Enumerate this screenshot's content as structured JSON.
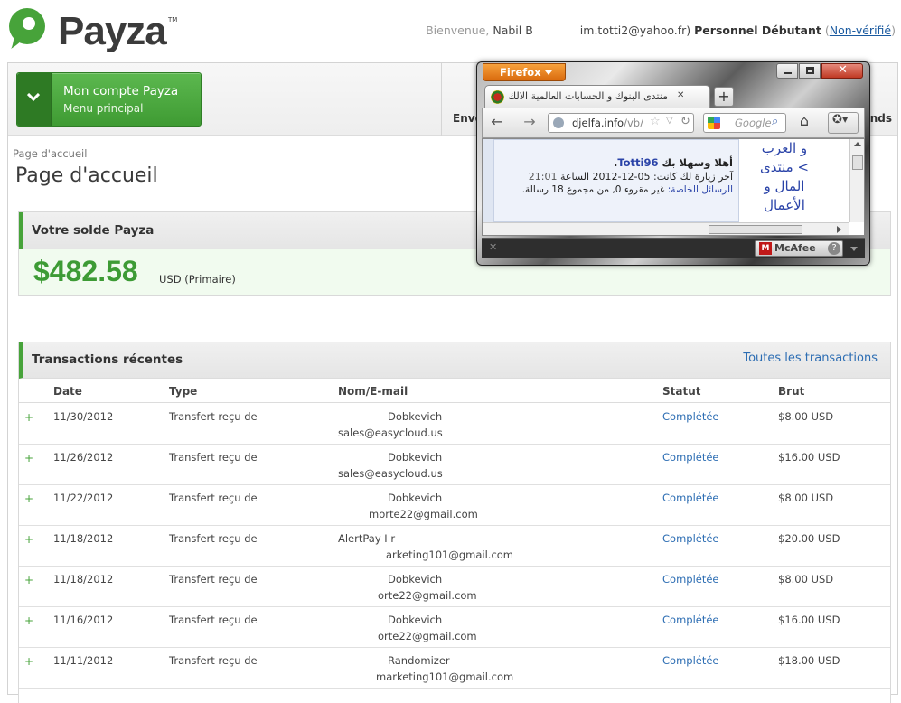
{
  "brand": {
    "name": "Payza",
    "tm": "TM",
    "colors": {
      "green": "#47a33a",
      "dark_text": "#3b3b3b",
      "link": "#2c6db3"
    }
  },
  "userbar": {
    "welcome": "Bienvenue,",
    "name": "Nabil B",
    "email_fragment": "im.totti2@yahoo.fr)",
    "level": "Personnel Débutant",
    "open_paren": "(",
    "verify_link": "Non-vérifié",
    "close_paren": ")"
  },
  "nav": {
    "account_button": {
      "line1": "Mon compte Payza",
      "line2": "Menu principal"
    },
    "envoyer": "Envoy",
    "funds": "nds"
  },
  "breadcrumb": "Page d'accueil",
  "page_title": "Page d'accueil",
  "balance": {
    "header": "Votre solde Payza",
    "amount": "$482.58",
    "currency": "USD (Primaire)"
  },
  "transactions": {
    "header": "Transactions récentes",
    "all_link": "Toutes les transactions",
    "columns": [
      "Date",
      "Type",
      "Nom/E-mail",
      "Statut",
      "Brut"
    ],
    "rows": [
      {
        "sign": "+",
        "date": "11/30/2012",
        "type": "Transfert reçu de",
        "name": "Dobkevich",
        "email": "sales@easycloud.us",
        "status": "Complétée",
        "amount": "$8.00 USD"
      },
      {
        "sign": "+",
        "date": "11/26/2012",
        "type": "Transfert reçu de",
        "name": "Dobkevich",
        "email": "sales@easycloud.us",
        "status": "Complétée",
        "amount": "$16.00 USD"
      },
      {
        "sign": "+",
        "date": "11/22/2012",
        "type": "Transfert reçu de",
        "name": "Dobkevich",
        "email": "morte22@gmail.com",
        "status": "Complétée",
        "amount": "$8.00 USD"
      },
      {
        "sign": "+",
        "date": "11/18/2012",
        "type": "Transfert reçu de",
        "name": "AlertPay I r",
        "email": "arketing101@gmail.com",
        "status": "Complétée",
        "amount": "$20.00 USD"
      },
      {
        "sign": "+",
        "date": "11/18/2012",
        "type": "Transfert reçu de",
        "name": "Dobkevich",
        "email": "orte22@gmail.com",
        "status": "Complétée",
        "amount": "$8.00 USD"
      },
      {
        "sign": "+",
        "date": "11/16/2012",
        "type": "Transfert reçu de",
        "name": "Dobkevich",
        "email": "orte22@gmail.com",
        "status": "Complétée",
        "amount": "$16.00 USD"
      },
      {
        "sign": "+",
        "date": "11/11/2012",
        "type": "Transfert reçu de",
        "name": "Randomizer",
        "email": "marketing101@gmail.com",
        "status": "Complétée",
        "amount": "$18.00 USD"
      }
    ]
  },
  "firefox": {
    "menu_button": "Firefox",
    "tab_title": "منتدى البنوك و الحسابات العالمية الالك...",
    "new_tab": "+",
    "url_domain": "djelfa.info",
    "url_path": "/vb/",
    "search_placeholder": "Google",
    "welcome_line": "أهلا وسهلا بك",
    "username": "Totti96",
    "last_visit_label": "آخر زيارة لك كانت:",
    "last_visit_date": "05-12-2012",
    "last_visit_at": "الساعة",
    "last_visit_time": "21:01",
    "pm_label": "الرسائل الخاصة:",
    "pm_text": "غير مقروء 0, من مجموع 18 رسالة.",
    "forum_lines": [
      "و العرب",
      "> منتدى",
      "المال و",
      "الأعمال"
    ],
    "addon": "McAfee"
  }
}
